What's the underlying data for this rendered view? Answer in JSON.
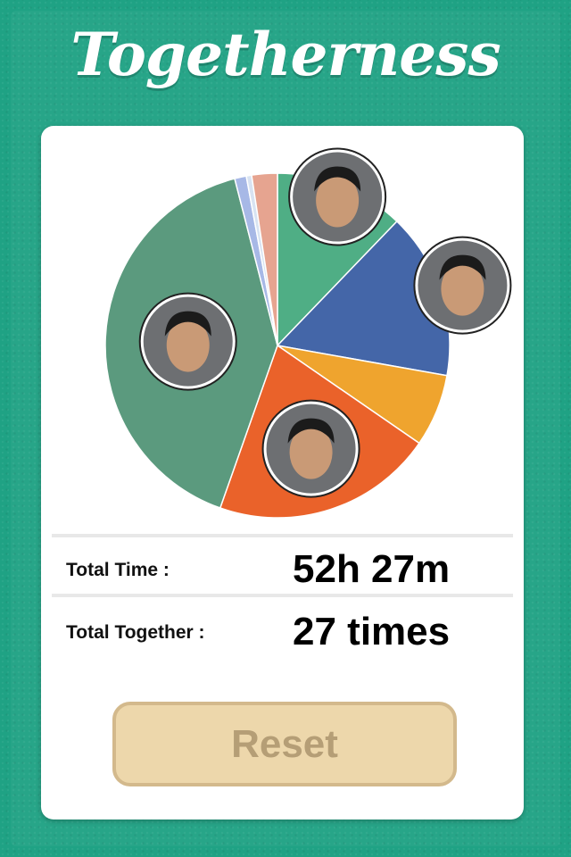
{
  "app": {
    "title": "Togetherness"
  },
  "stats": {
    "total_time_label": "Total Time :",
    "total_time_value": "52h 27m",
    "total_together_label": "Total Together :",
    "total_together_value": "27 times"
  },
  "actions": {
    "reset_label": "Reset"
  },
  "colors": {
    "background": "#1fa284",
    "card": "#ffffff",
    "button_fill": "#edd7ab",
    "button_text": "#b59e76"
  },
  "chart_data": {
    "type": "pie",
    "slices": [
      {
        "value": 12.2,
        "color": "#4fae85",
        "avatar": "friend-1"
      },
      {
        "value": 15.6,
        "color": "#4466a8",
        "avatar": "friend-2"
      },
      {
        "value": 6.8,
        "color": "#efa42e",
        "avatar": null
      },
      {
        "value": 20.8,
        "color": "#ea622a",
        "avatar": "friend-3"
      },
      {
        "value": 40.6,
        "color": "#5b9a7e",
        "avatar": "friend-4"
      },
      {
        "value": 1.1,
        "color": "#a7b8e6",
        "avatar": null
      },
      {
        "value": 0.5,
        "color": "#d8e3f2",
        "avatar": null
      },
      {
        "value": 2.4,
        "color": "#e6a490",
        "avatar": null
      }
    ]
  }
}
